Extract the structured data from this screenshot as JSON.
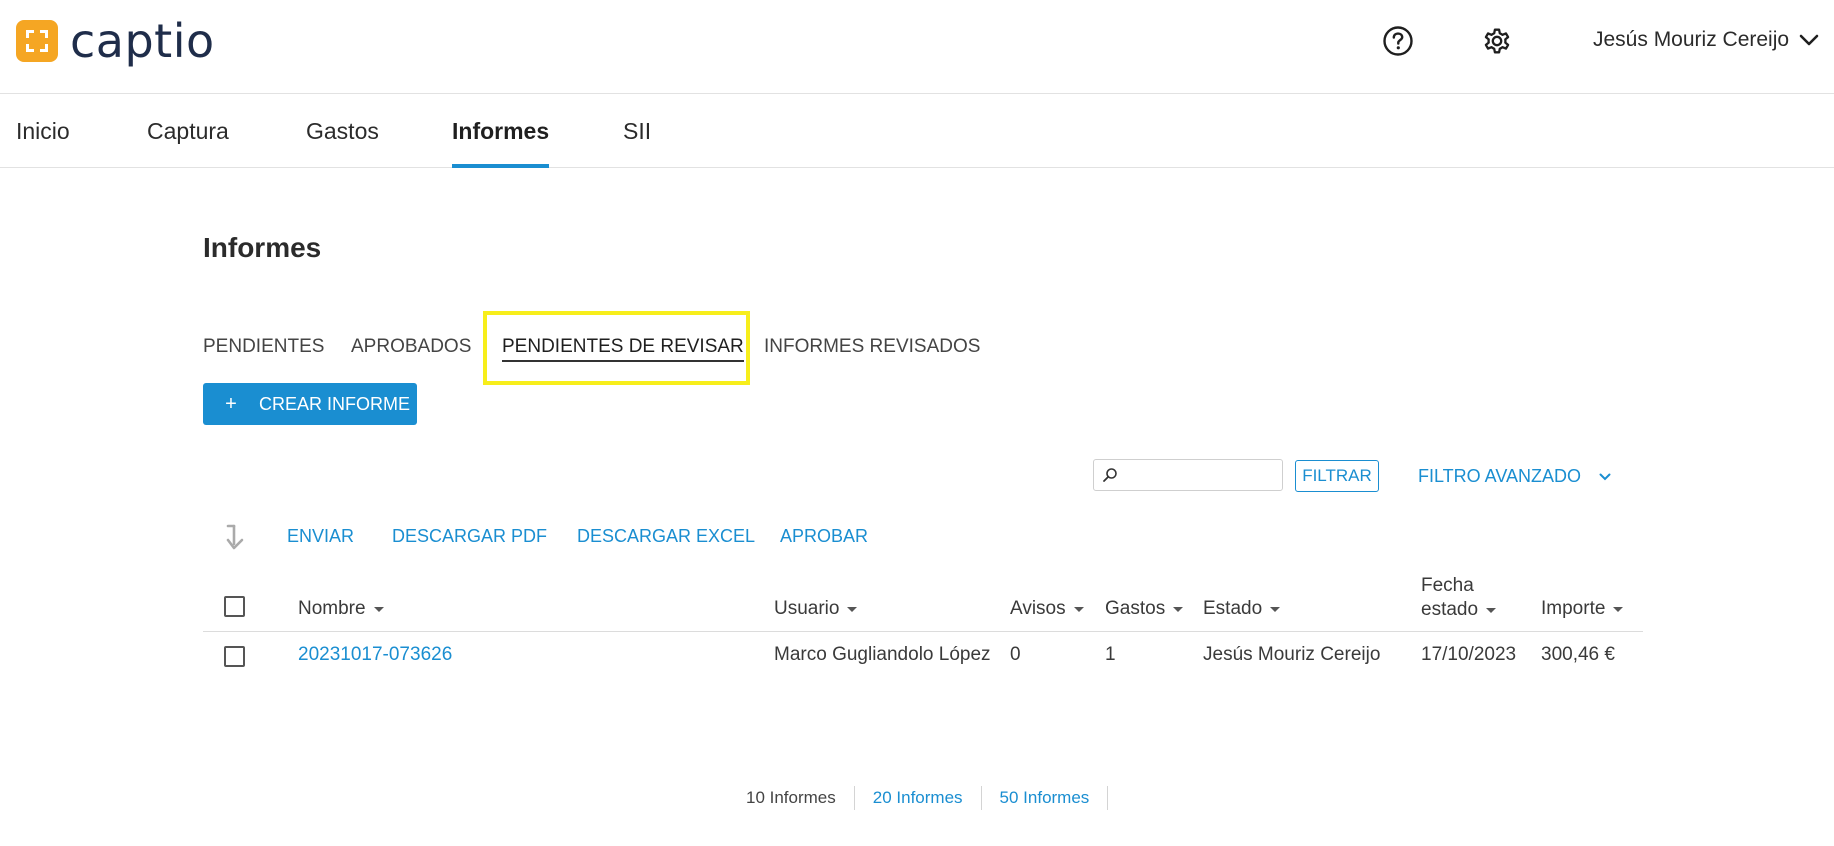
{
  "app": {
    "logo_text": "captio",
    "brand_color": "#f5a623",
    "accent_color": "#1a8ed1"
  },
  "header": {
    "help_icon": "help-circle-icon",
    "settings_icon": "gear-icon",
    "user_name": "Jesús Mouriz Cereijo"
  },
  "nav": {
    "items": [
      {
        "label": "Inicio",
        "active": false
      },
      {
        "label": "Captura",
        "active": false
      },
      {
        "label": "Gastos",
        "active": false
      },
      {
        "label": "Informes",
        "active": true
      },
      {
        "label": "SII",
        "active": false
      }
    ]
  },
  "page": {
    "title": "Informes",
    "tabs": [
      {
        "label": "PENDIENTES",
        "active": false
      },
      {
        "label": "APROBADOS",
        "active": false
      },
      {
        "label": "PENDIENTES DE REVISAR",
        "active": true
      },
      {
        "label": "INFORMES REVISADOS",
        "active": false
      }
    ],
    "create_button": {
      "icon": "+",
      "label": "CREAR INFORME"
    }
  },
  "filters": {
    "search_value": "",
    "search_placeholder": "",
    "filter_label": "FILTRAR",
    "advanced_label": "FILTRO AVANZADO"
  },
  "actions": {
    "items": [
      "ENVIAR",
      "DESCARGAR PDF",
      "DESCARGAR EXCEL",
      "APROBAR"
    ]
  },
  "table": {
    "columns": {
      "nombre": "Nombre",
      "usuario": "Usuario",
      "avisos": "Avisos",
      "gastos": "Gastos",
      "estado": "Estado",
      "fecha_line1": "Fecha",
      "fecha_line2": "estado",
      "importe": "Importe"
    },
    "rows": [
      {
        "nombre": "20231017-073626",
        "usuario": "Marco Gugliandolo López",
        "avisos": "0",
        "gastos": "1",
        "estado": "Jesús Mouriz Cereijo",
        "fecha": "17/10/2023",
        "importe": "300,46 €"
      }
    ]
  },
  "pagination": {
    "options": [
      "10 Informes",
      "20 Informes",
      "50 Informes"
    ],
    "current_index": 0
  }
}
